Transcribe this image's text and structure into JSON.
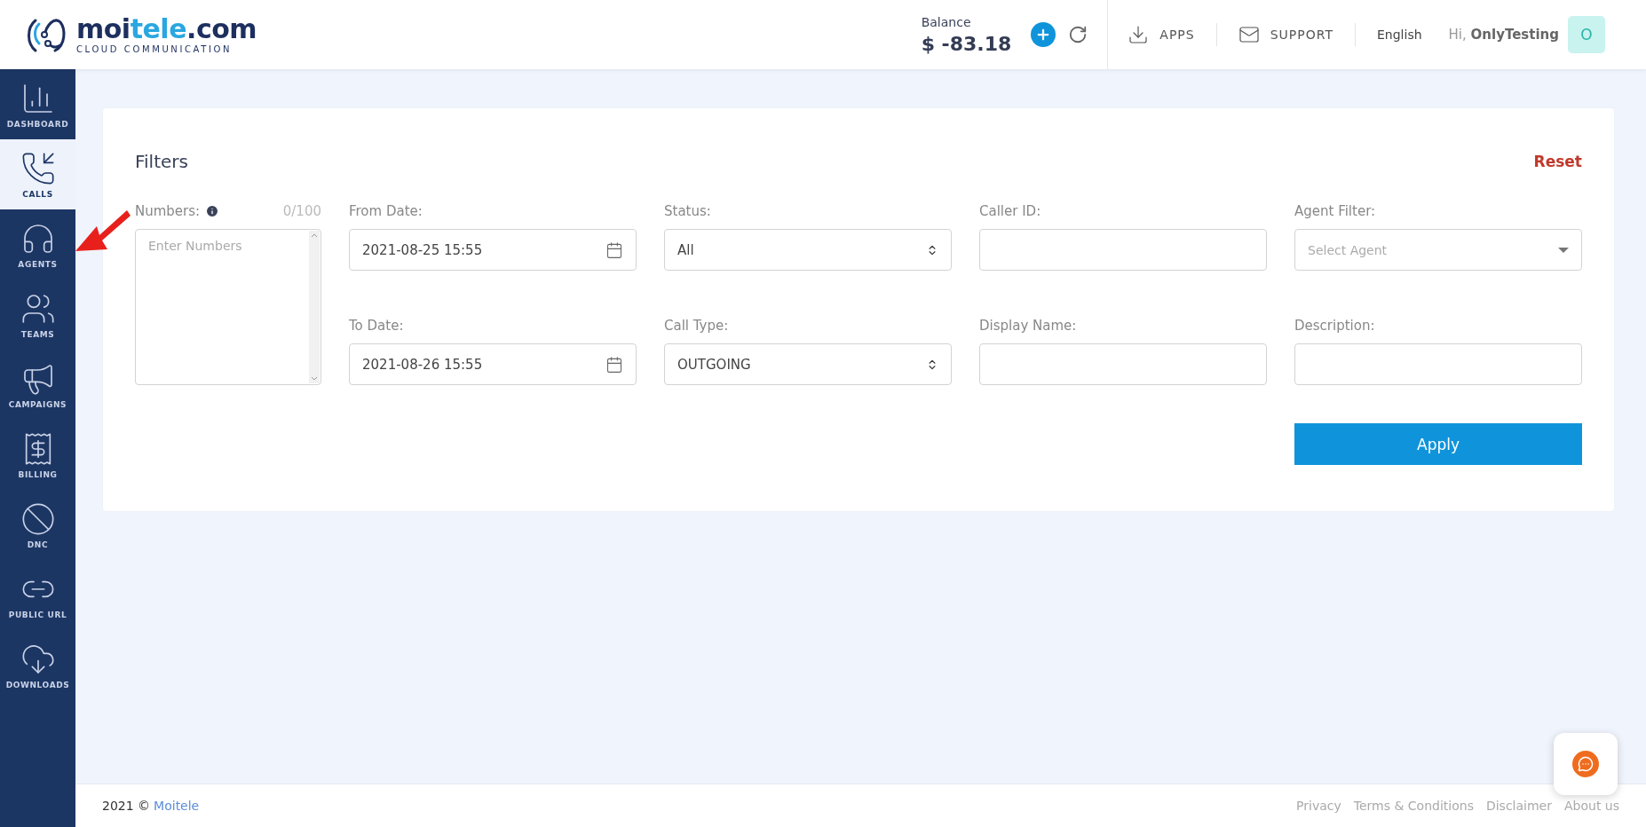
{
  "header": {
    "brand": [
      "moi",
      "tele",
      ".com"
    ],
    "tagline": "CLOUD COMMUNICATION",
    "balance_label": "Balance",
    "balance": "$ -83.18",
    "nav": [
      {
        "kind": "apps",
        "label": "APPS"
      },
      {
        "kind": "support",
        "label": "SUPPORT"
      }
    ],
    "language": "English",
    "greeting": "Hi,",
    "user": "OnlyTesting",
    "avatar": "O"
  },
  "sidebar": {
    "items": [
      {
        "kind": "dashboard",
        "label": "DASHBOARD",
        "selected": false
      },
      {
        "kind": "calls",
        "label": "CALLS",
        "selected": true
      },
      {
        "kind": "agents",
        "label": "AGENTS",
        "selected": false
      },
      {
        "kind": "teams",
        "label": "TEAMS",
        "selected": false
      },
      {
        "kind": "campaigns",
        "label": "CAMPAIGNS",
        "selected": false
      },
      {
        "kind": "billing",
        "label": "BILLING",
        "selected": false
      },
      {
        "kind": "dnc",
        "label": "DNC",
        "selected": false
      },
      {
        "kind": "public_url",
        "label": "PUBLIC URL",
        "selected": false
      },
      {
        "kind": "downloads",
        "label": "DOWNLOADS",
        "selected": false
      }
    ]
  },
  "filters": {
    "title": "Filters",
    "reset": "Reset",
    "fields": [
      {
        "kind": "textarea",
        "label": "Numbers:",
        "counter": "0/100",
        "placeholder": "Enter Numbers"
      },
      {
        "kind": "date",
        "label": "From Date:",
        "value": "2021-08-25 15:55"
      },
      {
        "kind": "select",
        "label": "Status:",
        "value": "All"
      },
      {
        "kind": "text",
        "label": "Caller ID:"
      },
      {
        "kind": "combo",
        "label": "Agent Filter:",
        "placeholder": "Select Agent"
      },
      {
        "kind": "date",
        "label": "To Date:",
        "value": "2021-08-26 15:55"
      },
      {
        "kind": "select",
        "label": "Call Type:",
        "value": "OUTGOING"
      },
      {
        "kind": "text",
        "label": "Display Name:"
      },
      {
        "kind": "text",
        "label": "Description:"
      }
    ],
    "apply": "Apply"
  },
  "footer": {
    "copyright": "2021 ©",
    "company": "Moitele",
    "links": [
      "Privacy",
      "Terms & Conditions",
      "Disclaimer",
      "About us"
    ]
  }
}
